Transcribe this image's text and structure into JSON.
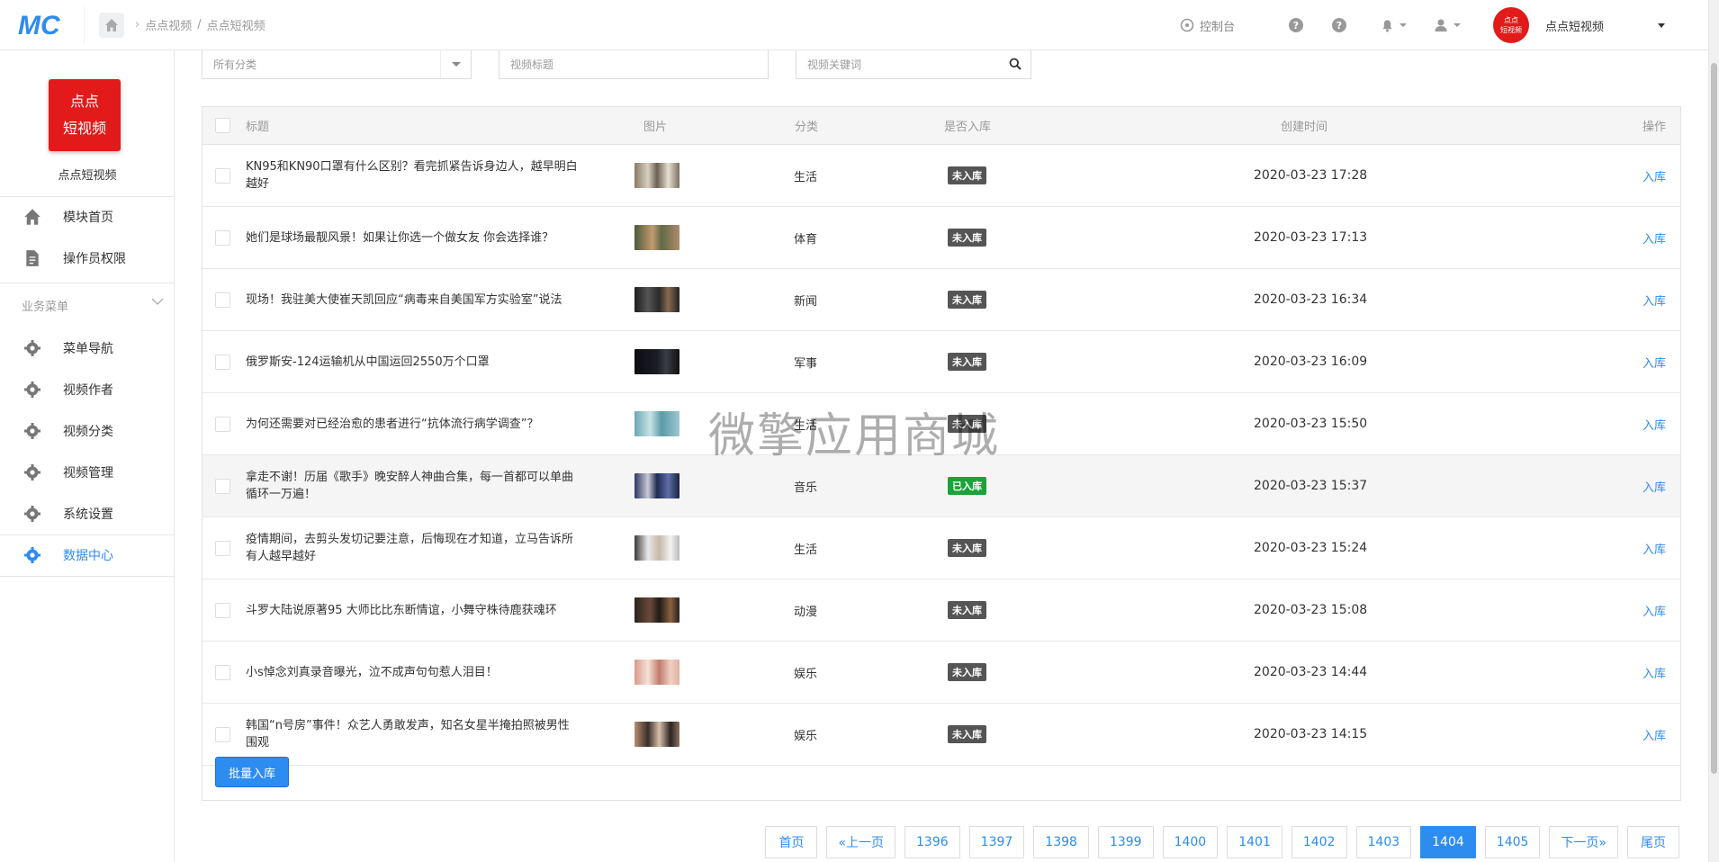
{
  "header": {
    "logo_text": "MC",
    "breadcrumb": [
      "点点视频",
      "点点短视频"
    ],
    "breadcrumb_sep": "/",
    "console_label": "控制台",
    "avatar_text": [
      "点点",
      "短视频"
    ],
    "user_name": "点点短视频"
  },
  "sidebar": {
    "brand_box": [
      "点点",
      "短视频"
    ],
    "brand_name": "点点短视频",
    "top_items": [
      "模块首页",
      "操作员权限"
    ],
    "section_title": "业务菜单",
    "items": [
      "菜单导航",
      "视频作者",
      "视频分类",
      "视频管理",
      "系统设置",
      "数据中心"
    ]
  },
  "filters": {
    "category_placeholder": "所有分类",
    "title_placeholder": "视频标题",
    "keyword_placeholder": "视频关键词"
  },
  "table": {
    "headers": {
      "title": "标题",
      "image": "图片",
      "category": "分类",
      "stored": "是否入库",
      "created": "创建时间",
      "action": "操作"
    },
    "rows": [
      {
        "title": "KN95和KN90口罩有什么区别？看完抓紧告诉身边人，越早明白越好",
        "category": "生活",
        "status": "未入库",
        "time": "2020-03-23 17:28",
        "action": "入库"
      },
      {
        "title": "她们是球场最靓风景！如果让你选一个做女友 你会选择谁？",
        "category": "体育",
        "status": "未入库",
        "time": "2020-03-23 17:13",
        "action": "入库"
      },
      {
        "title": "现场！我驻美大使崔天凯回应“病毒来自美国军方实验室”说法",
        "category": "新闻",
        "status": "未入库",
        "time": "2020-03-23 16:34",
        "action": "入库"
      },
      {
        "title": "俄罗斯安-124运输机从中国运回2550万个口罩",
        "category": "军事",
        "status": "未入库",
        "time": "2020-03-23 16:09",
        "action": "入库"
      },
      {
        "title": "为何还需要对已经治愈的患者进行“抗体流行病学调查”？",
        "category": "生活",
        "status": "未入库",
        "time": "2020-03-23 15:50",
        "action": "入库"
      },
      {
        "title": "拿走不谢！历届《歌手》晚安醉人神曲合集，每一首都可以单曲循环一万遍！",
        "category": "音乐",
        "status": "已入库",
        "time": "2020-03-23 15:37",
        "action": "入库"
      },
      {
        "title": "疫情期间，去剪头发切记要注意，后悔现在才知道，立马告诉所有人越早越好",
        "category": "生活",
        "status": "未入库",
        "time": "2020-03-23 15:24",
        "action": "入库"
      },
      {
        "title": "斗罗大陆说原著95 大师比比东断情谊，小舞守株待鹿获魂环",
        "category": "动漫",
        "status": "未入库",
        "time": "2020-03-23 15:08",
        "action": "入库"
      },
      {
        "title": "小s悼念刘真录音曝光，泣不成声句句惹人泪目！",
        "category": "娱乐",
        "status": "未入库",
        "time": "2020-03-23 14:44",
        "action": "入库"
      },
      {
        "title": "韩国“n号房”事件！众艺人勇敢发声，知名女星半掩拍照被男性围观",
        "category": "娱乐",
        "status": "未入库",
        "time": "2020-03-23 14:15",
        "action": "入库"
      }
    ],
    "batch_button": "批量入库"
  },
  "pagination": {
    "first": "首页",
    "prev": "«上一页",
    "pages": [
      "1396",
      "1397",
      "1398",
      "1399",
      "1400",
      "1401",
      "1402",
      "1403",
      "1404",
      "1405"
    ],
    "current": "1404",
    "next": "下一页»",
    "last": "尾页"
  },
  "watermark": "微擎应用商城",
  "colors": {
    "brand_red": "#e21a1a",
    "accent_blue": "#2d8cf0",
    "stored_green": "#1aa33a",
    "unstored_gray": "#555555"
  }
}
